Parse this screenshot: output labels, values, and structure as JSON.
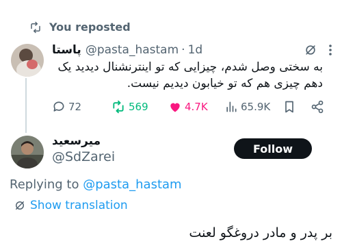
{
  "repost": {
    "label": "You reposted"
  },
  "tweet": {
    "author_name": "پاستا",
    "handle": "@pasta_hastam",
    "separator": "·",
    "time": "1d",
    "text_line1": "به سختی وصل شدم، چیزایی که تو اینترنشنال دیدید یک",
    "text_line2": "دهم چیزی هم که تو خیابون دیدیم نیست.",
    "stats": {
      "replies": "72",
      "reposts": "569",
      "likes": "4.7K",
      "views": "65.9K"
    }
  },
  "reply": {
    "author_name": "میرسعید",
    "handle": "@SdZarei",
    "follow_label": "Follow",
    "replying_prefix": "Replying to",
    "replying_mention": "@pasta_hastam",
    "show_translation": "Show translation",
    "text": "بر پدر و مادر دروغگو لعنت"
  },
  "colors": {
    "repost_green": "#00ba7c",
    "like_pink": "#f91880",
    "link_blue": "#1d9bf0",
    "muted_gray": "#536471"
  }
}
